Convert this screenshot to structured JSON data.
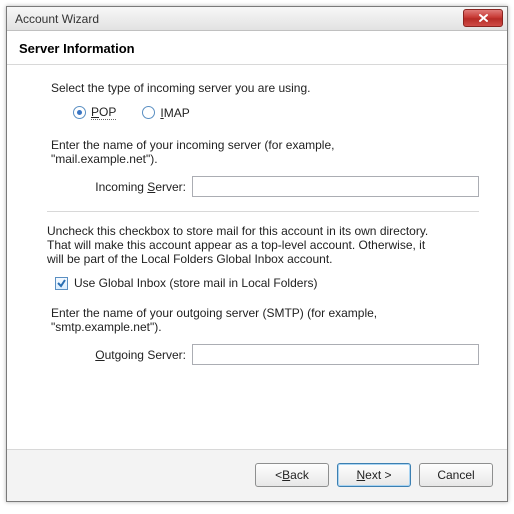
{
  "window": {
    "title": "Account Wizard",
    "heading": "Server Information"
  },
  "instructions": {
    "server_type": "Select the type of incoming server you are using.",
    "incoming_prompt_line1": "Enter the name of your incoming server (for example,",
    "incoming_prompt_line2": "\"mail.example.net\").",
    "global_inbox_line1": "Uncheck this checkbox to store mail for this account in its own directory.",
    "global_inbox_line2": "That will make this account appear as a top-level account. Otherwise, it",
    "global_inbox_line3": "will be part of the Local Folders Global Inbox account.",
    "outgoing_prompt_line1": "Enter the name of your outgoing server (SMTP) (for example,",
    "outgoing_prompt_line2": "\"smtp.example.net\")."
  },
  "radios": {
    "pop": {
      "label_pre": "P",
      "label_rest": "OP",
      "selected": true
    },
    "imap": {
      "label_pre": "I",
      "label_rest": "MAP",
      "selected": false
    }
  },
  "fields": {
    "incoming_label_pre": "Incoming ",
    "incoming_label_u": "S",
    "incoming_label_post": "erver:",
    "incoming_value": "",
    "outgoing_label_u": "O",
    "outgoing_label_post": "utgoing Server:",
    "outgoing_value": ""
  },
  "checkbox": {
    "checked": true,
    "label": "Use Global Inbox (store mail in Local Folders)"
  },
  "buttons": {
    "back_pre": "< ",
    "back_u": "B",
    "back_post": "ack",
    "next_u": "N",
    "next_post": "ext >",
    "cancel": "Cancel"
  }
}
